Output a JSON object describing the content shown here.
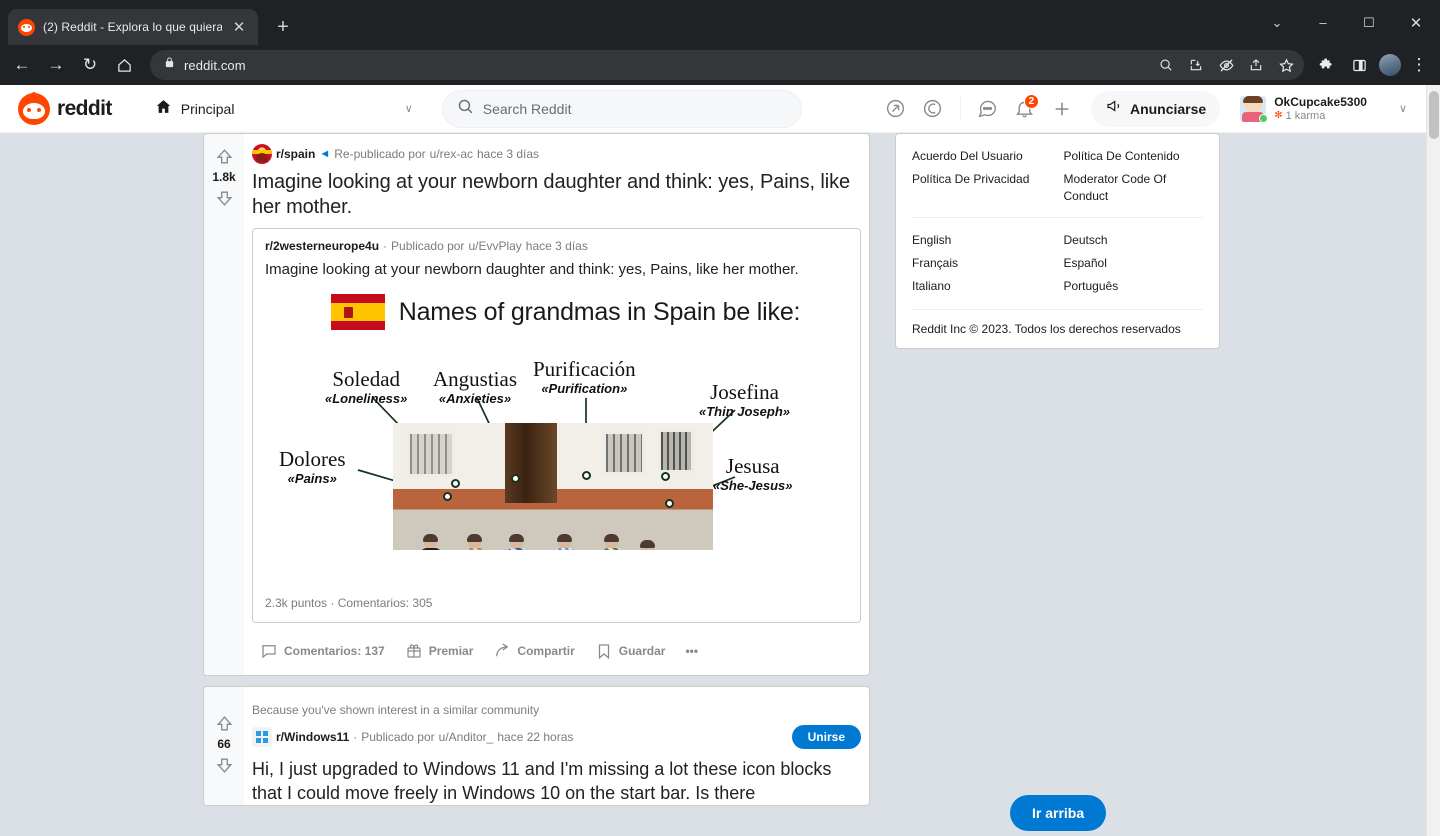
{
  "browser": {
    "tab": {
      "title": "(2) Reddit - Explora lo que quiera",
      "close_label": "✕"
    },
    "new_tab_label": "+",
    "window": {
      "minimize": "–",
      "maximize": "☐",
      "close": "✕",
      "tablist": "⌄"
    },
    "nav": {
      "back": "←",
      "forward": "→",
      "reload": "↻",
      "home": "⌂"
    },
    "address": {
      "url": "reddit.com",
      "lock_icon": "lock-icon"
    },
    "toolbar_icons": [
      "search-icon",
      "install-icon",
      "tracking-protection-icon",
      "share-icon",
      "bookmark-star-icon",
      "extensions-icon",
      "side-panel-icon",
      "profile-avatar",
      "menu-dots-icon"
    ]
  },
  "reddit": {
    "logo_text": "reddit",
    "nav_dropdown": {
      "label": "Principal",
      "icon": "home-icon",
      "chevron": "∨"
    },
    "search": {
      "placeholder": "Search Reddit",
      "icon": "search-icon"
    },
    "header_icons": {
      "popular": "trending-icon",
      "coins": "coin-icon",
      "chat": "chat-icon",
      "notifications": "bell-icon",
      "notifications_badge": "2",
      "create": "+"
    },
    "advertise_button": "Anunciarse",
    "user": {
      "name": "OkCupcake5300",
      "karma": "1 karma",
      "chevron": "∨"
    }
  },
  "post": {
    "score": "1.8k",
    "upvote_icon": "upvote-arrow-icon",
    "downvote_icon": "downvote-arrow-icon",
    "subreddit": "r/spain",
    "crosspost_icon": "crosspost-icon",
    "meta": "Re-publicado por",
    "author": "u/rex-ac",
    "time": "hace 3 días",
    "title": "Imagine looking at your newborn daughter and think: yes, Pains, like her mother.",
    "crosspost": {
      "subreddit": "r/2westerneurope4u",
      "separator": "·",
      "posted_by": "Publicado por",
      "author": "u/EvvPlay",
      "time": "hace 3 días",
      "title": "Imagine looking at your newborn daughter and think: yes, Pains, like her mother.",
      "stats": "2.3k puntos · Comentarios: 305"
    },
    "meme": {
      "flag": "spain-flag-icon",
      "headline": "Names of grandmas in Spain be like:",
      "labels": [
        {
          "name": "Soledad",
          "meaning": "«Loneliness»"
        },
        {
          "name": "Angustias",
          "meaning": "«Anxieties»"
        },
        {
          "name": "Purificación",
          "meaning": "«Purification»"
        },
        {
          "name": "Josefina",
          "meaning": "«Thin Joseph»"
        },
        {
          "name": "Dolores",
          "meaning": "«Pains»"
        },
        {
          "name": "Jesusa",
          "meaning": "«She-Jesus»"
        }
      ]
    },
    "actions": [
      {
        "icon": "comment-icon",
        "label": "Comentarios: 137"
      },
      {
        "icon": "award-icon",
        "label": "Premiar"
      },
      {
        "icon": "share-icon",
        "label": "Compartir"
      },
      {
        "icon": "bookmark-icon",
        "label": "Guardar"
      },
      {
        "icon": "more-dots-icon",
        "label": "•••"
      }
    ]
  },
  "post2": {
    "score": "66",
    "reason": "Because you've shown interest in a similar community",
    "subreddit": "r/Windows11",
    "separator": "·",
    "posted_by": "Publicado por",
    "author": "u/Anditor_",
    "time": "hace 22 horas",
    "join_label": "Unirse",
    "title": "Hi, I just upgraded to Windows 11 and I'm missing a lot these icon blocks that I could move freely in Windows 10 on the start bar. Is there"
  },
  "sidebar": {
    "links": [
      "Acuerdo Del Usuario",
      "Política De Contenido",
      "Política De Privacidad",
      "Moderator Code Of Conduct"
    ],
    "languages": [
      "English",
      "Deutsch",
      "Français",
      "Español",
      "Italiano",
      "Português"
    ],
    "copyright": "Reddit Inc © 2023. Todos los derechos reservados"
  },
  "go_top_button": "Ir arriba",
  "colors": {
    "reddit_orange": "#ff4500",
    "reddit_blue": "#0079d3",
    "page_bg": "#dae0e6",
    "chrome_dark": "#202124"
  }
}
